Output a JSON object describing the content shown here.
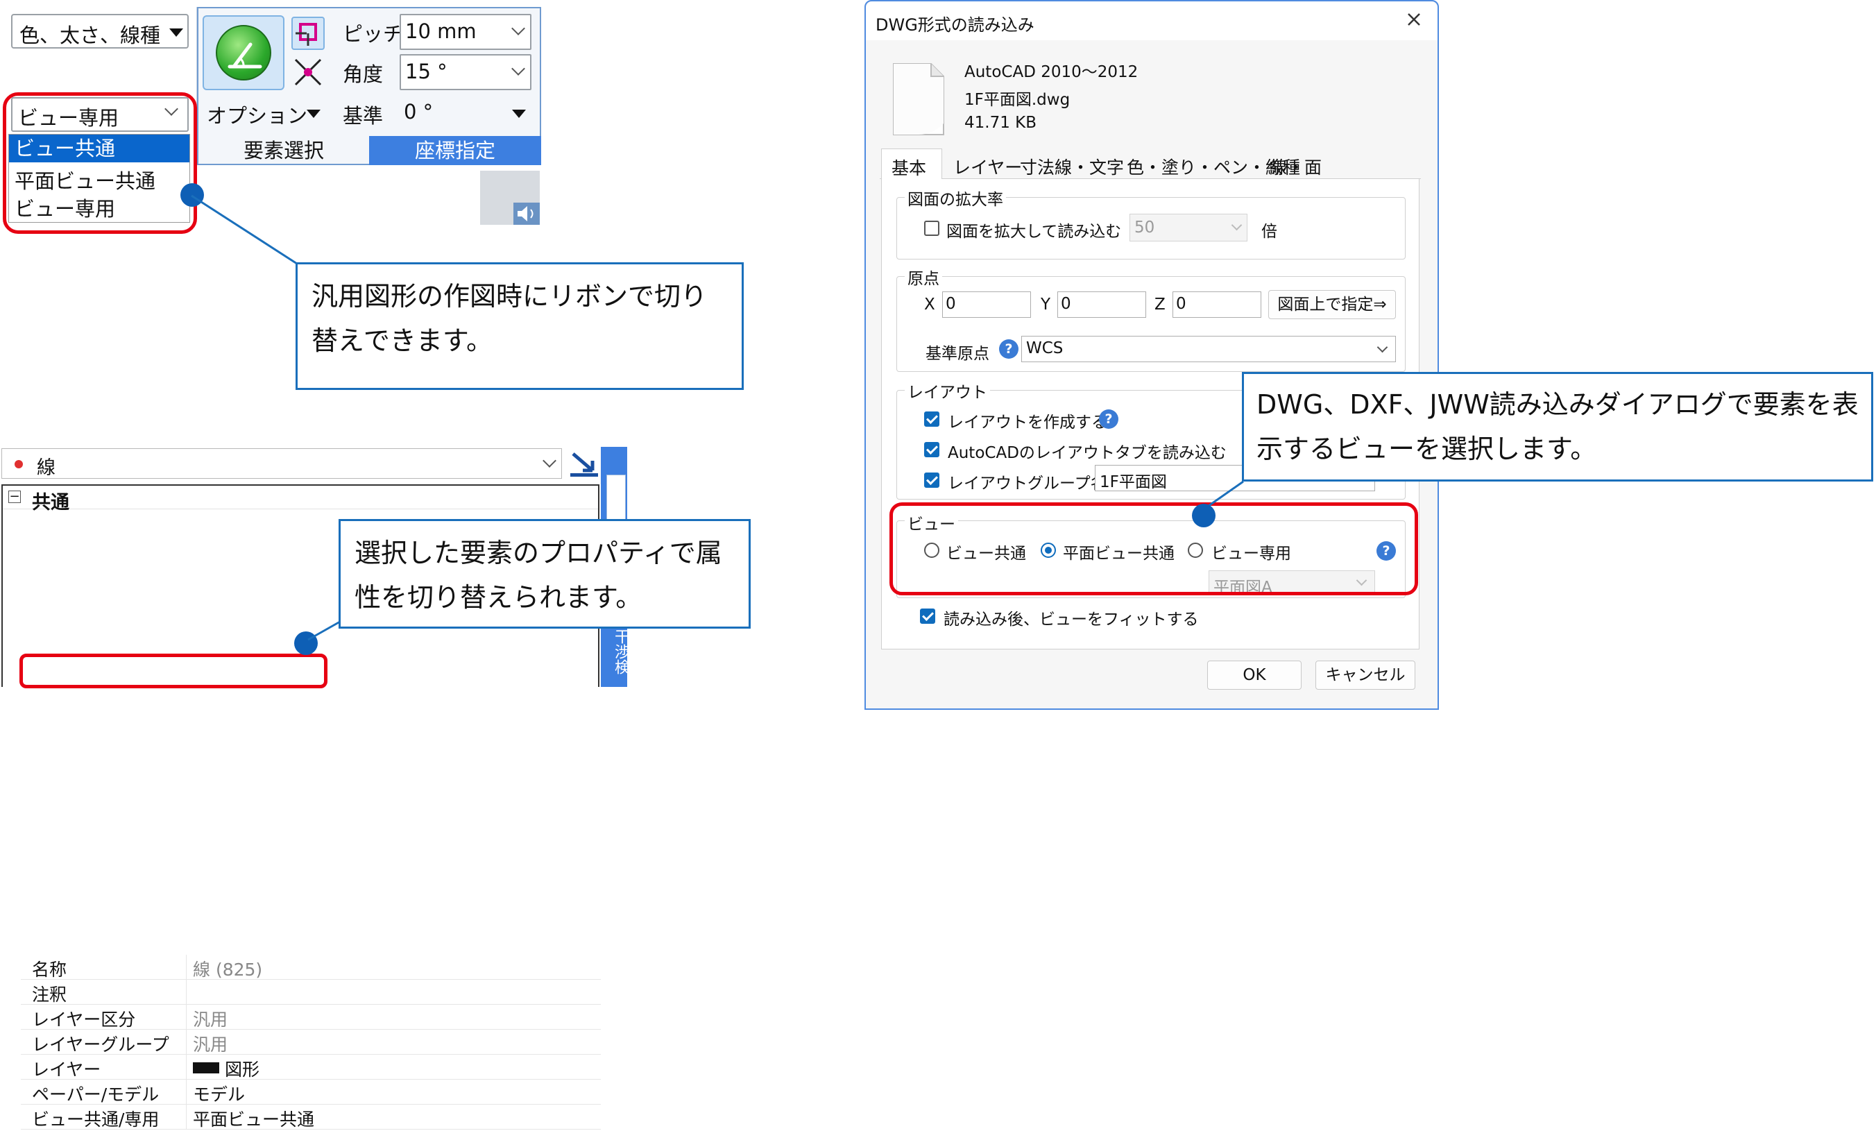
{
  "ribbon": {
    "color_dropdown": "色、太さ、線種",
    "view_dropdown": "ビュー専用",
    "view_options": [
      "ビュー共通",
      "平面ビュー共通",
      "ビュー専用"
    ],
    "pitch_label": "ピッチ",
    "pitch_value": "10 mm",
    "angle_label": "角度",
    "angle_value": "15 °",
    "option_label": "オプション",
    "base_label": "基準",
    "base_value": "0 °",
    "tab_select": "要素選択",
    "tab_coord": "座標指定"
  },
  "callouts": {
    "ribbon_note": "汎用図形の作図時にリボンで切り替えできます。",
    "property_note": "選択した要素のプロパティで属性を切り替えられます。",
    "dialog_note": "DWG、DXF、JWW読み込みダイアログで要素を表示するビューを選択します。"
  },
  "props": {
    "element_name": "線",
    "group": "共通",
    "rows": [
      {
        "key": "名称",
        "value": "線 (825)",
        "grey": true
      },
      {
        "key": "注釈",
        "value": "",
        "grey": true
      },
      {
        "key": "レイヤー区分",
        "value": "汎用",
        "grey": true
      },
      {
        "key": "レイヤーグループ",
        "value": "汎用",
        "grey": true
      },
      {
        "key": "レイヤー",
        "value": "図形",
        "grey": false
      },
      {
        "key": "ペーパー/モデル",
        "value": "モデル",
        "grey": false
      },
      {
        "key": "ビュー共通/専用",
        "value": "平面ビュー共通",
        "grey": false
      }
    ],
    "side_tab": "干渉検"
  },
  "dialog": {
    "title": "DWG形式の読み込み",
    "file_version": "AutoCAD 2010～2012",
    "file_name": "1F平面図.dwg",
    "file_size": "41.71 KB",
    "tabs": [
      "基本",
      "レイヤー",
      "寸法線・文字",
      "色・塗り・ペン・線種",
      "線・面"
    ],
    "scale_group": "図面の拡大率",
    "scale_check": "図面を拡大して読み込む",
    "scale_value": "50",
    "scale_unit": "倍",
    "origin_group": "原点",
    "x_label": "X",
    "x_value": "0",
    "y_label": "Y",
    "y_value": "0",
    "z_label": "Z",
    "z_value": "0",
    "pick_button": "図面上で指定⇒",
    "base_origin_label": "基準原点",
    "base_origin_value": "WCS",
    "layout_group": "レイアウト",
    "layout_create": "レイアウトを作成する",
    "layout_tabs": "AutoCADのレイアウトタブを読み込む",
    "layout_group_name_label": "レイアウトグループ名",
    "layout_group_name_value": "1F平面図",
    "view_group": "ビュー",
    "view_radio1": "ビュー共通",
    "view_radio2": "平面ビュー共通",
    "view_radio3": "ビュー専用",
    "view_select": "平面図A",
    "fit_check": "読み込み後、ビューをフィットする",
    "ok": "OK",
    "cancel": "キャンセル"
  }
}
